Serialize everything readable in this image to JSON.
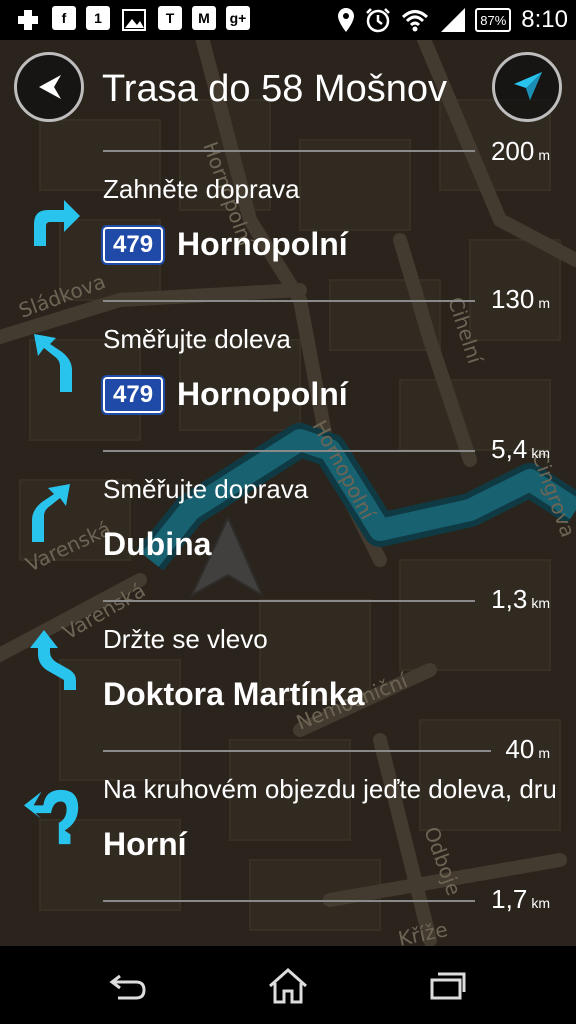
{
  "status_bar": {
    "left_icons": [
      "plus-icon",
      "facebook-icon",
      "calendar-icon",
      "image-icon",
      "t-icon",
      "gmail-icon",
      "gplus-icon"
    ],
    "right_icons": [
      "location-icon",
      "alarm-icon",
      "wifi-icon",
      "signal-icon"
    ],
    "battery": "87%",
    "time": "8:10"
  },
  "header": {
    "title": "Trasa do 58 Mošnov"
  },
  "top_distance": {
    "value": "200",
    "unit": "m"
  },
  "instructions": [
    {
      "icon": "turn-right-icon",
      "text": "Zahněte doprava",
      "shield": "479",
      "street": "Hornopolní",
      "dist_value": "130",
      "dist_unit": "m"
    },
    {
      "icon": "bear-left-icon",
      "text": "Směřujte doleva",
      "shield": "479",
      "street": "Hornopolní",
      "dist_value": "5,4",
      "dist_unit": "km"
    },
    {
      "icon": "bear-right-icon",
      "text": "Směřujte doprava",
      "shield": "",
      "street": "Dubina",
      "dist_value": "1,3",
      "dist_unit": "km"
    },
    {
      "icon": "keep-left-icon",
      "text": "Držte se vlevo",
      "shield": "",
      "street": "Doktora Martínka",
      "dist_value": "40",
      "dist_unit": "m"
    },
    {
      "icon": "roundabout-left-icon",
      "text": "Na kruhovém objezdu jeďte doleva, dru",
      "shield": "",
      "street": "Horní",
      "dist_value": "1,7",
      "dist_unit": "km"
    }
  ],
  "map_labels": [
    "Hornopolní",
    "Sládkova",
    "Cihelní",
    "Hornopolní",
    "Varenská",
    "Varenská",
    "Cingrova",
    "Nemocniční",
    "Odboje",
    "Kříže"
  ],
  "colors": {
    "route": "#1aa3c4",
    "arrow": "#29c4ee",
    "shield": "#1f4aa8"
  }
}
